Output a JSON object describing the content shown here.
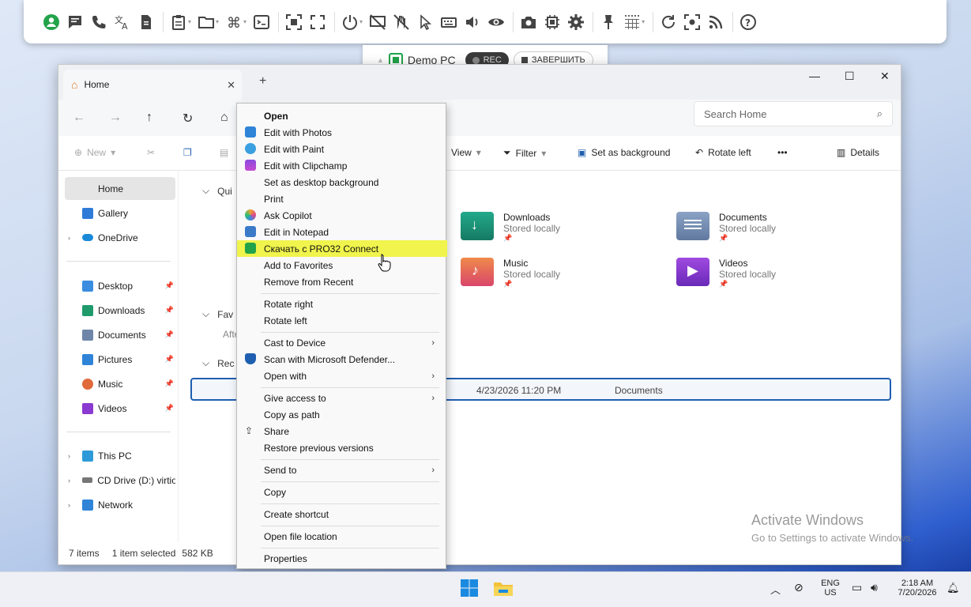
{
  "toolbar": {
    "icons": [
      "user-status-icon",
      "chat-icon",
      "phone-icon",
      "translate-icon",
      "document-icon",
      "clipboard-icon",
      "folder-icon",
      "command-icon",
      "terminal-icon",
      "fit-screen-icon",
      "fullscreen-icon",
      "power-icon",
      "display-off-icon",
      "block-input-icon",
      "pointer-icon",
      "keyboard-icon",
      "volume-icon",
      "view-icon",
      "screenshot-icon",
      "chip-icon",
      "settings-icon",
      "pin-icon",
      "grid-icon",
      "refresh-icon",
      "scan-icon",
      "feed-icon",
      "help-icon"
    ]
  },
  "session": {
    "name": "Demo PC",
    "rec": "REC",
    "finish": "ЗАВЕРШИТЬ"
  },
  "window": {
    "tab_title": "Home",
    "search_placeholder": "Search Home"
  },
  "cmdbar": {
    "new": "New",
    "view": "View",
    "filter": "Filter",
    "set_bg": "Set as background",
    "rotate_left": "Rotate left",
    "more": "•••",
    "details": "Details"
  },
  "sidebar": {
    "items": [
      {
        "label": "Home",
        "pinned": false
      },
      {
        "label": "Gallery",
        "pinned": false
      },
      {
        "label": "OneDrive",
        "pinned": false
      },
      {
        "label": "Desktop",
        "pinned": true
      },
      {
        "label": "Downloads",
        "pinned": true
      },
      {
        "label": "Documents",
        "pinned": true
      },
      {
        "label": "Pictures",
        "pinned": true
      },
      {
        "label": "Music",
        "pinned": true
      },
      {
        "label": "Videos",
        "pinned": true
      },
      {
        "label": "This PC",
        "pinned": false
      },
      {
        "label": "CD Drive (D:) virtio-",
        "pinned": false
      },
      {
        "label": "Network",
        "pinned": false
      }
    ]
  },
  "sections": {
    "quick": "Qui",
    "favorites": "Fav",
    "favorites_sub": "Afte",
    "recent": "Rec"
  },
  "folders": [
    {
      "name": "Downloads",
      "status": "Stored locally"
    },
    {
      "name": "Documents",
      "status": "Stored locally"
    },
    {
      "name": "Music",
      "status": "Stored locally"
    },
    {
      "name": "Videos",
      "status": "Stored locally"
    }
  ],
  "recent_row": {
    "date": "4/23/2026 11:20 PM",
    "location": "Documents"
  },
  "status": {
    "items": "7 items",
    "selected": "1 item selected",
    "size": "582 KB"
  },
  "context_menu": [
    "Open",
    "Edit with Photos",
    "Edit with Paint",
    "Edit with Clipchamp",
    "Set as desktop background",
    "Print",
    "Ask Copilot",
    "Edit in Notepad",
    "Скачать с PRO32 Connect",
    "Add to Favorites",
    "Remove from Recent",
    "Rotate right",
    "Rotate left",
    "Cast to Device",
    "Scan with Microsoft Defender...",
    "Open with",
    "Give access to",
    "Copy as path",
    "Share",
    "Restore previous versions",
    "Send to",
    "Copy",
    "Create shortcut",
    "Open file location",
    "Properties"
  ],
  "activate": {
    "title": "Activate Windows",
    "sub": "Go to Settings to activate Windows."
  },
  "taskbar": {
    "lang1": "ENG",
    "lang2": "US",
    "time": "2:18 AM",
    "date": "7/20/2026"
  },
  "colors": {
    "accent": "#1f5fb0",
    "highlight": "#f0f44c",
    "green": "#22a34a"
  }
}
